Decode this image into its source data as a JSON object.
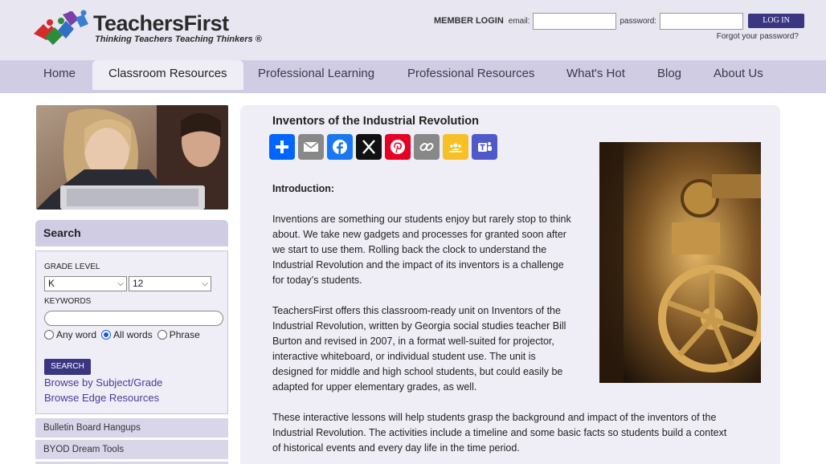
{
  "brand": {
    "name": "TeachersFirst",
    "tagline": "Thinking Teachers Teaching Thinkers ®"
  },
  "login": {
    "title": "MEMBER LOGIN",
    "email_label": "email:",
    "email_value": "",
    "password_label": "password:",
    "password_value": "",
    "button": "LOG IN",
    "forgot": "Forgot your password?"
  },
  "nav": {
    "items": [
      {
        "label": "Home"
      },
      {
        "label": "Classroom Resources",
        "active": true
      },
      {
        "label": "Professional Learning"
      },
      {
        "label": "Professional Resources"
      },
      {
        "label": "What's Hot"
      },
      {
        "label": "Blog"
      },
      {
        "label": "About Us"
      }
    ]
  },
  "sidebar": {
    "search_title": "Search",
    "grade_label": "GRADE LEVEL",
    "grade_from": "K",
    "grade_to": "12",
    "keywords_label": "KEYWORDS",
    "keywords_value": "",
    "radio": [
      {
        "label": "Any word",
        "checked": false
      },
      {
        "label": "All words",
        "checked": true
      },
      {
        "label": "Phrase",
        "checked": false
      }
    ],
    "search_button": "SEARCH",
    "links": [
      "Browse by Subject/Grade",
      "Browse Edge Resources"
    ],
    "items": [
      "Bulletin Board Hangups",
      "BYOD Dream Tools"
    ]
  },
  "article": {
    "title": "Inventors of the Industrial Revolution",
    "share_icons": [
      "share-plus-icon",
      "email-icon",
      "facebook-icon",
      "x-icon",
      "pinterest-icon",
      "copy-link-icon",
      "google-classroom-icon",
      "teams-icon"
    ],
    "intro_heading": "Introduction:",
    "para1_lines": [
      "Inventions are something our students enjoy but rarely stop to think",
      "about.  We take new gadgets and processes for granted soon after",
      "we start to use them. Rolling back the clock to understand the",
      "Industrial Revolution and the impact of its inventors is a challenge",
      "for today’s students."
    ],
    "para2_lines": [
      "TeachersFirst offers this classroom-ready unit on Inventors of the",
      "Industrial Revolution, written by Georgia social studies teacher Bill",
      "Burton and revised in 2007, in a format well-suited for projector,",
      "interactive whiteboard, or individual student use. The unit is",
      "designed for middle and high school students, but could easily be",
      "adapted for upper elementary grades, as well."
    ],
    "para3_lines": [
      "These interactive lessons will help students grasp the background and impact of the inventors of the",
      "Industrial Revolution. The activities include a timeline and some basic facts so students build a context",
      "of historical events and every day life in the time period."
    ]
  },
  "colors": {
    "header_bg": "#e8e6f1",
    "nav_bg": "#cfcce3",
    "panel_bg": "#efeef6",
    "button": "#3b3682",
    "link": "#4a3a9a"
  }
}
